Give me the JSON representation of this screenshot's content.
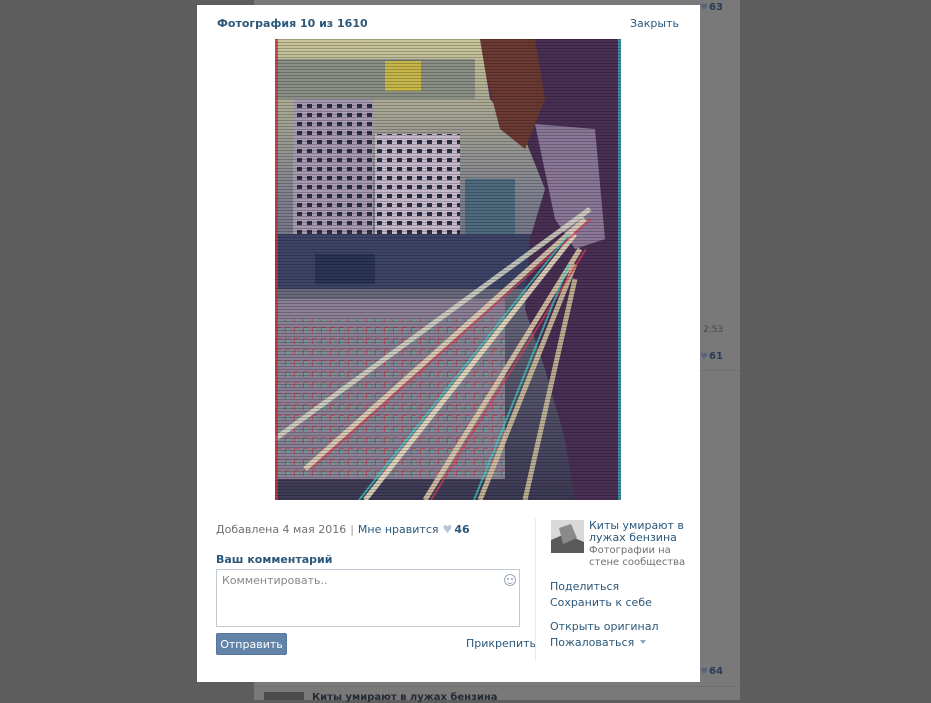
{
  "background": {
    "counts": [
      "63",
      "61",
      "64"
    ],
    "time": "2:53",
    "post_title": "Киты умирают в лужах бензина"
  },
  "viewer": {
    "title": "Фотография 10 из 1610",
    "close_label": "Закрыть"
  },
  "info": {
    "added": "Добавлена 4 мая 2016",
    "separator": "|",
    "like_label": "Мне нравится",
    "like_count": "46"
  },
  "comment": {
    "label": "Ваш комментарий",
    "placeholder": "Комментировать..",
    "send_label": "Отправить",
    "attach_label": "Прикрепить"
  },
  "album": {
    "name": "Киты умирают в лужах бензина",
    "subtitle": "Фотографии на стене сообщества"
  },
  "actions": {
    "share": "Поделиться",
    "save": "Сохранить к себе",
    "open_original": "Открыть оригинал",
    "report": "Пожаловаться"
  },
  "colors": {
    "link": "#2b587a",
    "button": "#6483a8",
    "overlay": "#5d5d5d"
  }
}
